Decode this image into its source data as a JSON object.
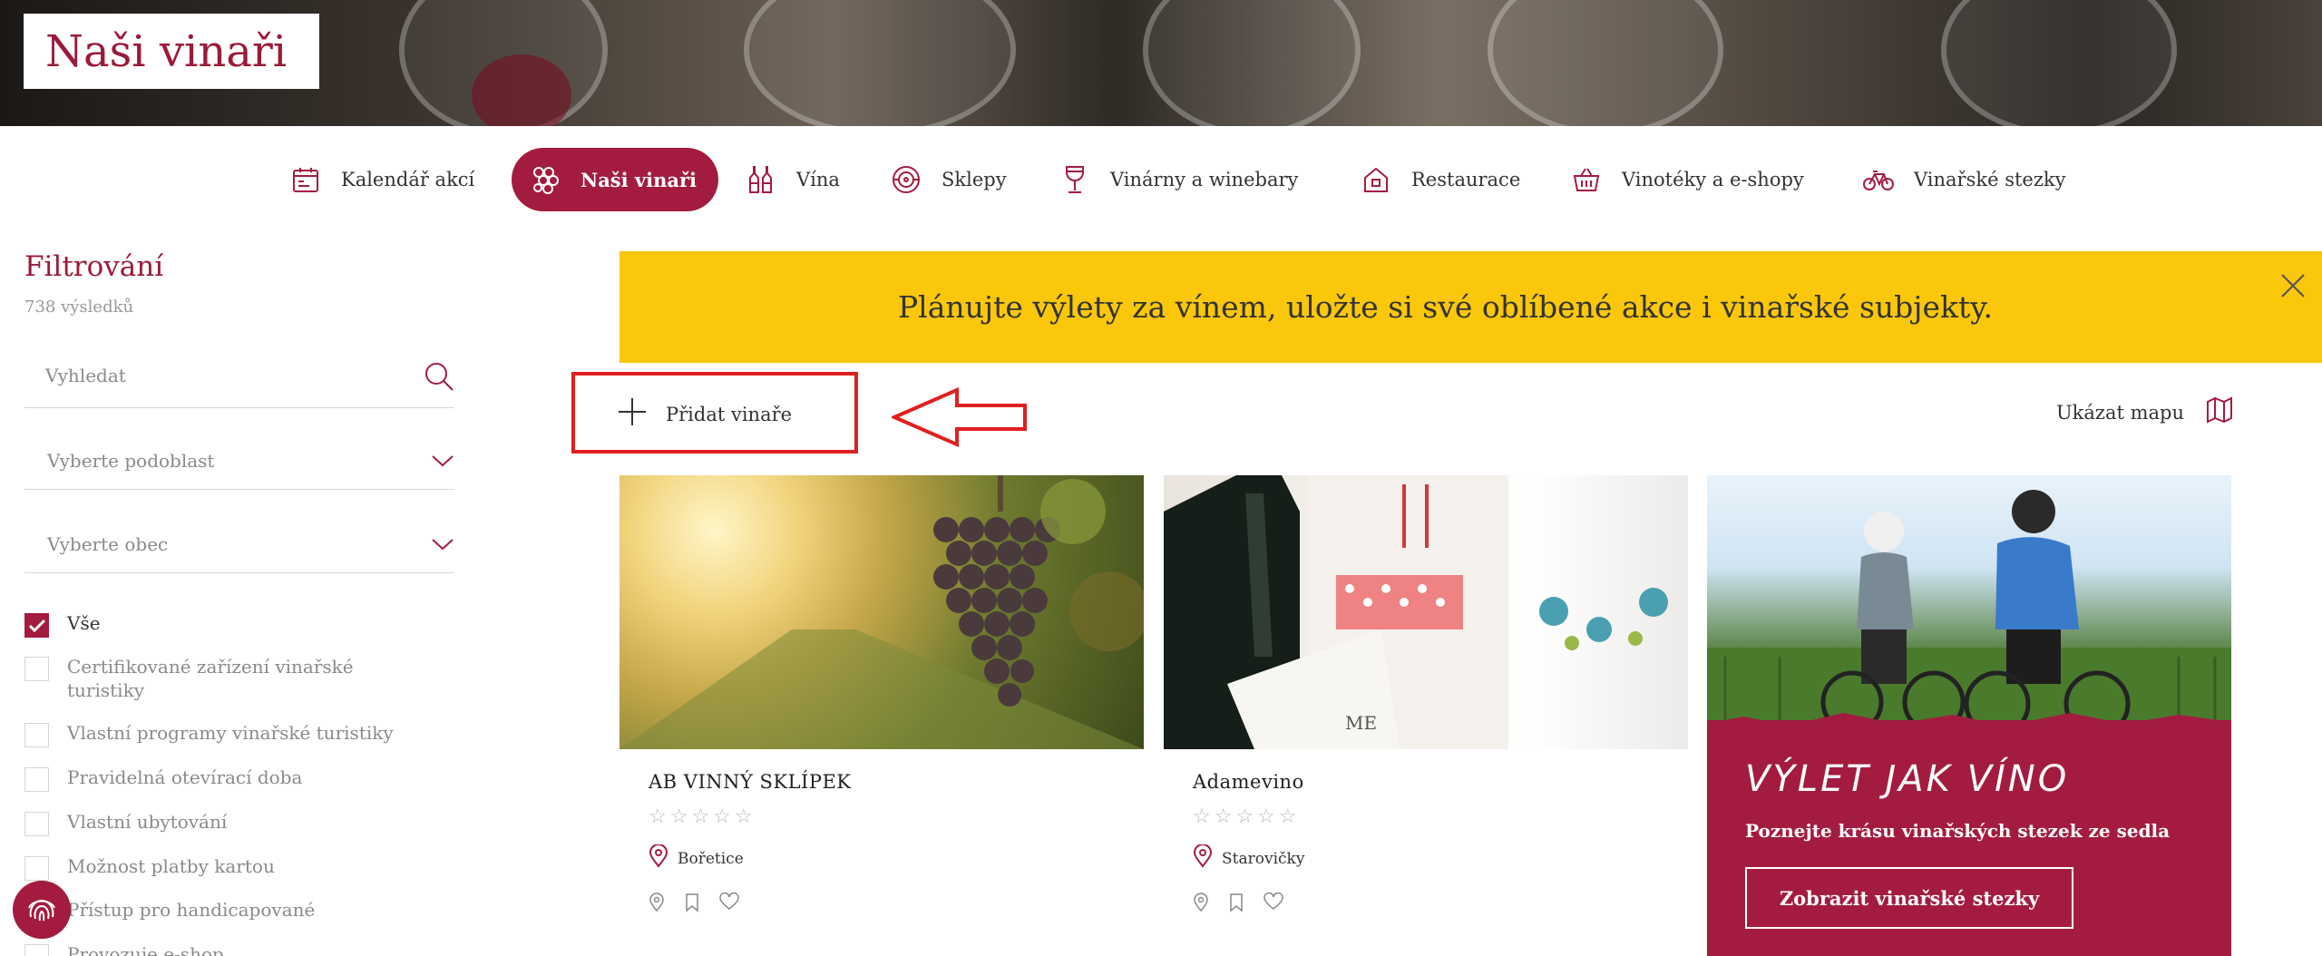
{
  "brand": {
    "logo": "Naši vinaři"
  },
  "nav": [
    {
      "label": "Kalendář akcí",
      "icon": "calendar-icon"
    },
    {
      "label": "Naši vinaři",
      "icon": "grapes-icon",
      "active": true
    },
    {
      "label": "Vína",
      "icon": "bottles-icon"
    },
    {
      "label": "Sklepy",
      "icon": "barrel-icon"
    },
    {
      "label": "Vinárny a winebary",
      "icon": "wine-glass-icon"
    },
    {
      "label": "Restaurace",
      "icon": "house-icon"
    },
    {
      "label": "Vinotéky a e-shopy",
      "icon": "basket-icon"
    },
    {
      "label": "Vinařské stezky",
      "icon": "bicycle-icon"
    }
  ],
  "sidebar": {
    "title": "Filtrování",
    "count": "738 výsledků",
    "search_placeholder": "Vyhledat",
    "subregion_placeholder": "Vyberte podoblast",
    "town_placeholder": "Vyberte obec",
    "checkboxes": [
      {
        "label": "Vše",
        "checked": true
      },
      {
        "label": "Certifikované zařízení vinařské turistiky",
        "checked": false
      },
      {
        "label": "Vlastní programy vinařské turistiky",
        "checked": false
      },
      {
        "label": "Pravidelná otevírací doba",
        "checked": false
      },
      {
        "label": "Vlastní ubytování",
        "checked": false
      },
      {
        "label": "Možnost platby kartou",
        "checked": false
      },
      {
        "label": "Přístup pro handicapované",
        "checked": false
      },
      {
        "label": "Provozuje e-shop",
        "checked": false
      }
    ]
  },
  "banner": {
    "text": "Plánujte výlety za vínem, uložte si své oblíbené akce i vinařské subjekty."
  },
  "toolbar": {
    "add_label": "Přidat vinaře",
    "map_label": "Ukázat mapu"
  },
  "cards": [
    {
      "name": "AB VINNÝ SKLÍPEK",
      "stars": "☆☆☆☆☆",
      "location": "Bořetice"
    },
    {
      "name": "Adamevino",
      "stars": "☆☆☆☆☆",
      "location": "Starovičky"
    }
  ],
  "promo": {
    "title": "VÝLET JAK VÍNO",
    "subtitle": "Poznejte krásu vinařských stezek ze sedla",
    "button": "Zobrazit vinařské stezky"
  },
  "colors": {
    "accent": "#a31c40",
    "banner": "#fac70a",
    "highlight": "#e02020"
  }
}
